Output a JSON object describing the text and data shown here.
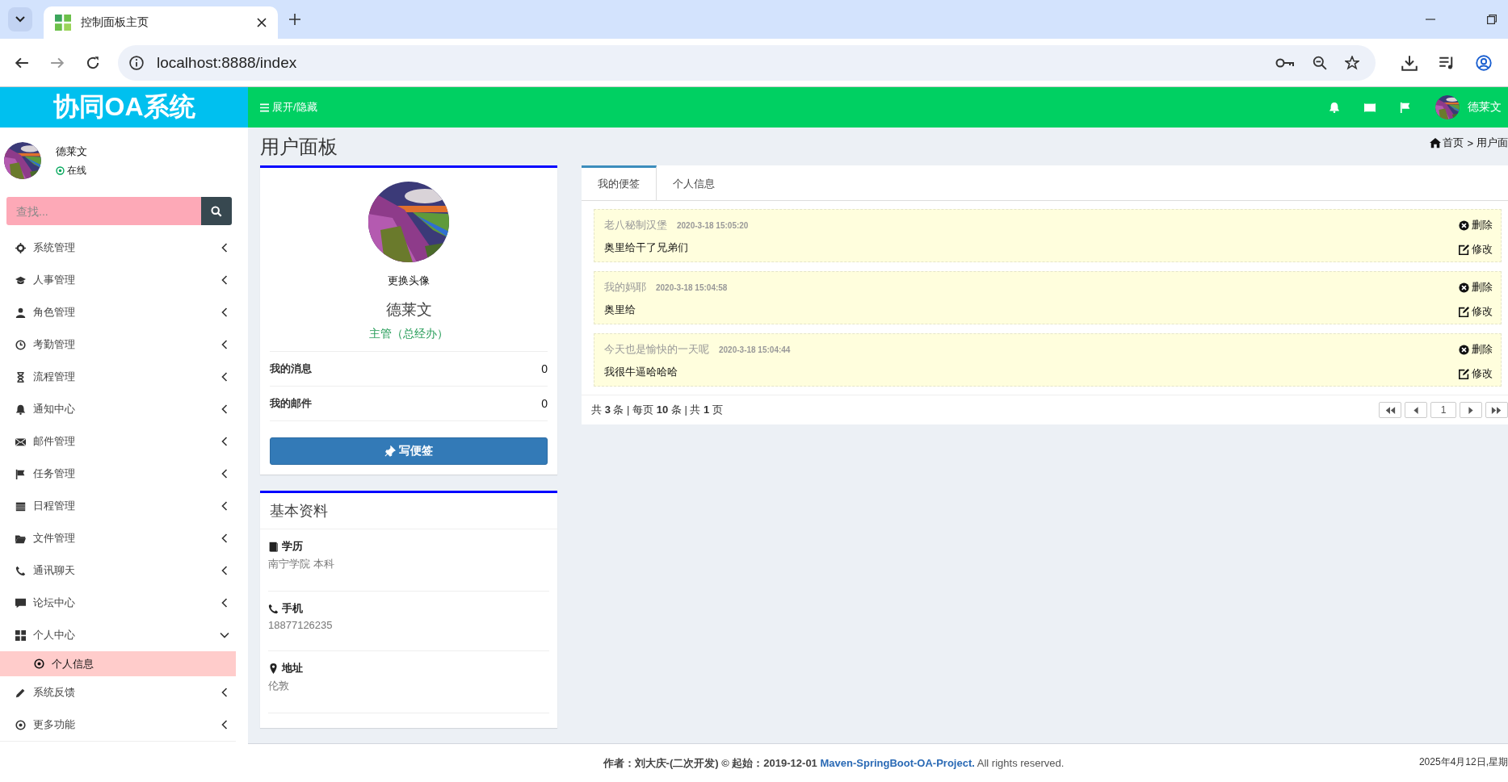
{
  "browser": {
    "tab_title": "控制面板主页",
    "url": "localhost:8888/index"
  },
  "header": {
    "logo": "协同OA系统",
    "toggle_label": "展开/隐藏",
    "user_name": "德莱文"
  },
  "sidebar": {
    "user": {
      "name": "德莱文",
      "status": "在线"
    },
    "search": {
      "placeholder": "查找..."
    },
    "items": [
      {
        "label": "系统管理",
        "expanded": false
      },
      {
        "label": "人事管理",
        "expanded": false
      },
      {
        "label": "角色管理",
        "expanded": false
      },
      {
        "label": "考勤管理",
        "expanded": false
      },
      {
        "label": "流程管理",
        "expanded": false
      },
      {
        "label": "通知中心",
        "expanded": false
      },
      {
        "label": "邮件管理",
        "expanded": false
      },
      {
        "label": "任务管理",
        "expanded": false
      },
      {
        "label": "日程管理",
        "expanded": false
      },
      {
        "label": "文件管理",
        "expanded": false
      },
      {
        "label": "通讯聊天",
        "expanded": false
      },
      {
        "label": "论坛中心",
        "expanded": false
      },
      {
        "label": "个人中心",
        "expanded": true,
        "children": [
          {
            "label": "个人信息",
            "selected": true
          }
        ]
      },
      {
        "label": "系统反馈",
        "expanded": false
      },
      {
        "label": "更多功能",
        "expanded": false
      }
    ]
  },
  "main": {
    "title": "用户面板",
    "breadcrumb": {
      "home": "首页",
      "separator": ">",
      "current": "用户面"
    },
    "profile": {
      "change_avatar": "更换头像",
      "name": "德莱文",
      "role": "主管（总经办）",
      "stats": [
        {
          "label": "我的消息",
          "value": "0"
        },
        {
          "label": "我的邮件",
          "value": "0"
        }
      ],
      "button": "写便签"
    },
    "basic_info": {
      "title": "基本资料",
      "fields": [
        {
          "label": "学历",
          "value": "南宁学院 本科"
        },
        {
          "label": "手机",
          "value": "18877126235"
        },
        {
          "label": "地址",
          "value": "伦敦"
        }
      ]
    },
    "notes_panel": {
      "tabs": [
        {
          "label": "我的便签",
          "selected": true
        },
        {
          "label": "个人信息",
          "selected": false
        }
      ],
      "notes": [
        {
          "title": "老八秘制汉堡",
          "time": "2020-3-18 15:05:20",
          "body": "奥里给干了兄弟们",
          "delete": "删除",
          "edit": "修改"
        },
        {
          "title": "我的妈耶",
          "time": "2020-3-18 15:04:58",
          "body": "奥里给",
          "delete": "删除",
          "edit": "修改"
        },
        {
          "title": "今天也是愉快的一天呢",
          "time": "2020-3-18 15:04:44",
          "body": "我很牛逼哈哈哈",
          "delete": "删除",
          "edit": "修改"
        }
      ],
      "pagination": {
        "summary": "共 **3** 条 | 每页 **10** 条 | 共 **1** 页",
        "page": "1"
      }
    }
  },
  "footer": {
    "credit": "作者：刘大庆-(二次开发) © 起始：2019-12-01",
    "link": "Maven-SpringBoot-OA-Project.",
    "rights": "All rights reserved.",
    "date": "2025年4月12日,星期"
  }
}
